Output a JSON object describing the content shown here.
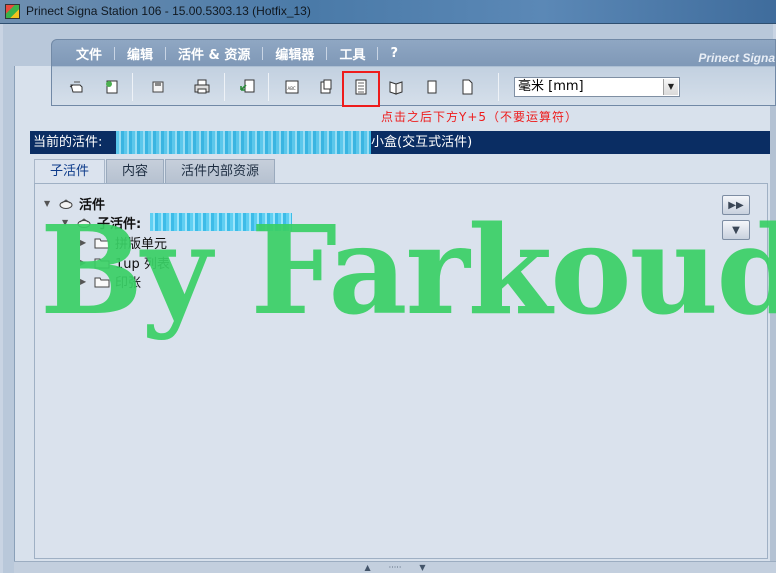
{
  "window": {
    "title": "Prinect Signa Station 106  -  15.00.5303.13 (Hotfix_13)"
  },
  "menu": {
    "items": [
      "文件",
      "编辑",
      "活件 & 资源",
      "编辑器",
      "工具",
      "?"
    ],
    "brand": "Prinect Signa"
  },
  "toolbar": {
    "unit_value": "毫米  [mm]",
    "icons": [
      "open-job-icon",
      "new-job-icon",
      "save-icon",
      "print-icon",
      "import-icon",
      "abc-sheet-icon",
      "sheet-copy-icon",
      "product-part-icon",
      "fold-sheet-icon",
      "single-page-icon",
      "blank-page-icon"
    ],
    "highlight_color": "#ee1c1c"
  },
  "annotation": "点击之后下方Y+5（不要运算符）",
  "job": {
    "label": "当前的活件:",
    "name": "小盒(交互式活件)"
  },
  "tabs": [
    "子活件",
    "内容",
    "活件内部资源"
  ],
  "tree": {
    "root": "活件",
    "subjob": "子活件:",
    "children": [
      "拼版单元",
      "1up 列表",
      "印张"
    ]
  },
  "watermark": "By Farkoud",
  "colors": {
    "job_bar": "#0a2d63",
    "watermark": "#3ad066",
    "active_tab_text": "#0d3b8a"
  }
}
